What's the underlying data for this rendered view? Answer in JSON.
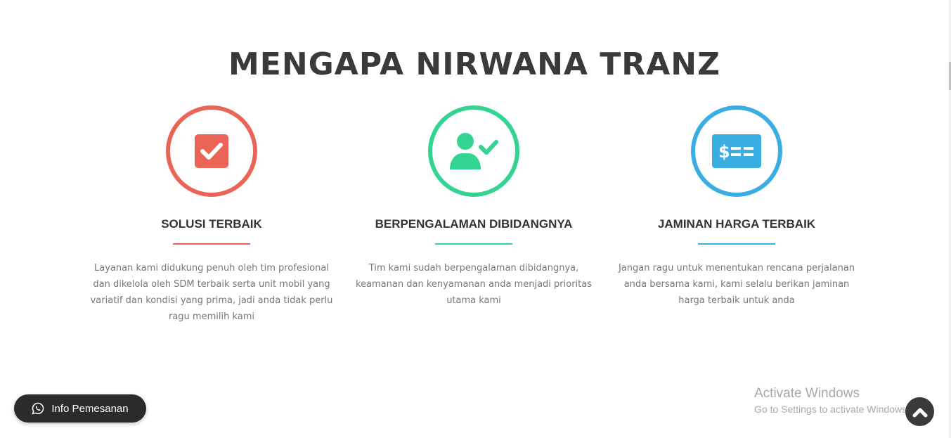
{
  "section": {
    "title": "MENGAPA NIRWANA TRANZ"
  },
  "features": [
    {
      "title": "SOLUSI TERBAIK",
      "description": "Layanan kami didukung penuh oleh tim profesional dan dikelola oleh SDM terbaik serta unit mobil yang variatif dan kondisi yang prima, jadi anda tidak perlu ragu memilih kami",
      "icon": "checkbox-icon",
      "color": "#EA6557"
    },
    {
      "title": "BERPENGALAMAN DIBIDANGNYA",
      "description": "Tim kami sudah berpengalaman dibidangnya, keamanan dan kenyamanan anda menjadi prioritas utama kami",
      "icon": "user-check-icon",
      "color": "#33D391"
    },
    {
      "title": "JAMINAN HARGA TERBAIK",
      "description": "Jangan ragu untuk menentukan rencana perjalanan anda bersama kami, kami selalu berikan jaminan harga terbaik untuk anda",
      "icon": "money-check-icon",
      "color": "#3AAEE3"
    }
  ],
  "info_button": {
    "label": "Info Pemesanan",
    "icon": "whatsapp-icon"
  },
  "activate_windows": {
    "title": "Activate Windows",
    "subtitle": "Go to Settings to activate Windows."
  },
  "scroll_top": {
    "icon": "chevron-up-icon"
  }
}
